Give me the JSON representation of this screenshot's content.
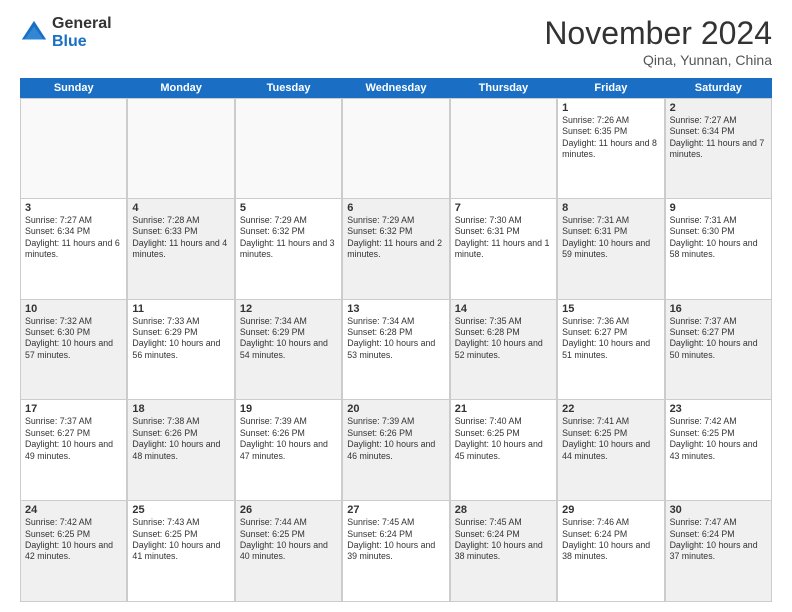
{
  "logo": {
    "general": "General",
    "blue": "Blue"
  },
  "header": {
    "month": "November 2024",
    "location": "Qina, Yunnan, China"
  },
  "weekdays": [
    "Sunday",
    "Monday",
    "Tuesday",
    "Wednesday",
    "Thursday",
    "Friday",
    "Saturday"
  ],
  "weeks": [
    [
      {
        "day": "",
        "info": "",
        "empty": true
      },
      {
        "day": "",
        "info": "",
        "empty": true
      },
      {
        "day": "",
        "info": "",
        "empty": true
      },
      {
        "day": "",
        "info": "",
        "empty": true
      },
      {
        "day": "",
        "info": "",
        "empty": true
      },
      {
        "day": "1",
        "info": "Sunrise: 7:26 AM\nSunset: 6:35 PM\nDaylight: 11 hours and 8 minutes."
      },
      {
        "day": "2",
        "info": "Sunrise: 7:27 AM\nSunset: 6:34 PM\nDaylight: 11 hours and 7 minutes.",
        "shaded": true
      }
    ],
    [
      {
        "day": "3",
        "info": "Sunrise: 7:27 AM\nSunset: 6:34 PM\nDaylight: 11 hours and 6 minutes."
      },
      {
        "day": "4",
        "info": "Sunrise: 7:28 AM\nSunset: 6:33 PM\nDaylight: 11 hours and 4 minutes.",
        "shaded": true
      },
      {
        "day": "5",
        "info": "Sunrise: 7:29 AM\nSunset: 6:32 PM\nDaylight: 11 hours and 3 minutes."
      },
      {
        "day": "6",
        "info": "Sunrise: 7:29 AM\nSunset: 6:32 PM\nDaylight: 11 hours and 2 minutes.",
        "shaded": true
      },
      {
        "day": "7",
        "info": "Sunrise: 7:30 AM\nSunset: 6:31 PM\nDaylight: 11 hours and 1 minute."
      },
      {
        "day": "8",
        "info": "Sunrise: 7:31 AM\nSunset: 6:31 PM\nDaylight: 10 hours and 59 minutes.",
        "shaded": true
      },
      {
        "day": "9",
        "info": "Sunrise: 7:31 AM\nSunset: 6:30 PM\nDaylight: 10 hours and 58 minutes."
      }
    ],
    [
      {
        "day": "10",
        "info": "Sunrise: 7:32 AM\nSunset: 6:30 PM\nDaylight: 10 hours and 57 minutes.",
        "shaded": true
      },
      {
        "day": "11",
        "info": "Sunrise: 7:33 AM\nSunset: 6:29 PM\nDaylight: 10 hours and 56 minutes."
      },
      {
        "day": "12",
        "info": "Sunrise: 7:34 AM\nSunset: 6:29 PM\nDaylight: 10 hours and 54 minutes.",
        "shaded": true
      },
      {
        "day": "13",
        "info": "Sunrise: 7:34 AM\nSunset: 6:28 PM\nDaylight: 10 hours and 53 minutes."
      },
      {
        "day": "14",
        "info": "Sunrise: 7:35 AM\nSunset: 6:28 PM\nDaylight: 10 hours and 52 minutes.",
        "shaded": true
      },
      {
        "day": "15",
        "info": "Sunrise: 7:36 AM\nSunset: 6:27 PM\nDaylight: 10 hours and 51 minutes."
      },
      {
        "day": "16",
        "info": "Sunrise: 7:37 AM\nSunset: 6:27 PM\nDaylight: 10 hours and 50 minutes.",
        "shaded": true
      }
    ],
    [
      {
        "day": "17",
        "info": "Sunrise: 7:37 AM\nSunset: 6:27 PM\nDaylight: 10 hours and 49 minutes."
      },
      {
        "day": "18",
        "info": "Sunrise: 7:38 AM\nSunset: 6:26 PM\nDaylight: 10 hours and 48 minutes.",
        "shaded": true
      },
      {
        "day": "19",
        "info": "Sunrise: 7:39 AM\nSunset: 6:26 PM\nDaylight: 10 hours and 47 minutes."
      },
      {
        "day": "20",
        "info": "Sunrise: 7:39 AM\nSunset: 6:26 PM\nDaylight: 10 hours and 46 minutes.",
        "shaded": true
      },
      {
        "day": "21",
        "info": "Sunrise: 7:40 AM\nSunset: 6:25 PM\nDaylight: 10 hours and 45 minutes."
      },
      {
        "day": "22",
        "info": "Sunrise: 7:41 AM\nSunset: 6:25 PM\nDaylight: 10 hours and 44 minutes.",
        "shaded": true
      },
      {
        "day": "23",
        "info": "Sunrise: 7:42 AM\nSunset: 6:25 PM\nDaylight: 10 hours and 43 minutes."
      }
    ],
    [
      {
        "day": "24",
        "info": "Sunrise: 7:42 AM\nSunset: 6:25 PM\nDaylight: 10 hours and 42 minutes.",
        "shaded": true
      },
      {
        "day": "25",
        "info": "Sunrise: 7:43 AM\nSunset: 6:25 PM\nDaylight: 10 hours and 41 minutes."
      },
      {
        "day": "26",
        "info": "Sunrise: 7:44 AM\nSunset: 6:25 PM\nDaylight: 10 hours and 40 minutes.",
        "shaded": true
      },
      {
        "day": "27",
        "info": "Sunrise: 7:45 AM\nSunset: 6:24 PM\nDaylight: 10 hours and 39 minutes."
      },
      {
        "day": "28",
        "info": "Sunrise: 7:45 AM\nSunset: 6:24 PM\nDaylight: 10 hours and 38 minutes.",
        "shaded": true
      },
      {
        "day": "29",
        "info": "Sunrise: 7:46 AM\nSunset: 6:24 PM\nDaylight: 10 hours and 38 minutes."
      },
      {
        "day": "30",
        "info": "Sunrise: 7:47 AM\nSunset: 6:24 PM\nDaylight: 10 hours and 37 minutes.",
        "shaded": true
      }
    ]
  ]
}
